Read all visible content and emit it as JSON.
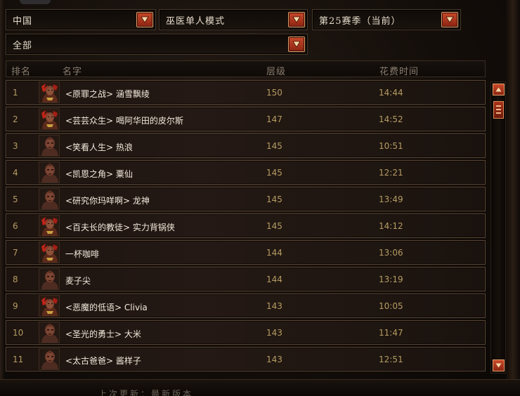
{
  "filters": {
    "region": "中国",
    "class_mode": "巫医单人模式",
    "season": "第25赛季（当前）",
    "category": "全部"
  },
  "columns": {
    "rank": "排名",
    "name": "名字",
    "tier": "层级",
    "time": "花费时间"
  },
  "rows": [
    {
      "rank": "1",
      "name": "<原罪之战> 涵雪飘绫",
      "tier": "150",
      "time": "14:44",
      "portrait": "female"
    },
    {
      "rank": "2",
      "name": "<芸芸众生> 喝阿华田的皮尔斯",
      "tier": "147",
      "time": "14:52",
      "portrait": "female"
    },
    {
      "rank": "3",
      "name": "<笑看人生> 热浪",
      "tier": "145",
      "time": "10:51",
      "portrait": "male"
    },
    {
      "rank": "4",
      "name": "<凯恩之角> 粟仙",
      "tier": "145",
      "time": "12:21",
      "portrait": "male"
    },
    {
      "rank": "5",
      "name": "<研究你玛咩啊> 龙神",
      "tier": "145",
      "time": "13:49",
      "portrait": "male"
    },
    {
      "rank": "6",
      "name": "<百夫长的教徒> 实力背锅侠",
      "tier": "145",
      "time": "14:12",
      "portrait": "female"
    },
    {
      "rank": "7",
      "name": "一杯咖啡",
      "tier": "144",
      "time": "13:06",
      "portrait": "female"
    },
    {
      "rank": "8",
      "name": "麦子尖",
      "tier": "144",
      "time": "13:19",
      "portrait": "male"
    },
    {
      "rank": "9",
      "name": "<恶魔的低语> Clivia",
      "tier": "143",
      "time": "10:05",
      "portrait": "female"
    },
    {
      "rank": "10",
      "name": "<圣光的勇士> 大米",
      "tier": "143",
      "time": "11:47",
      "portrait": "male"
    },
    {
      "rank": "11",
      "name": "<太古爸爸> 酱样子",
      "tier": "143",
      "time": "12:51",
      "portrait": "male"
    }
  ],
  "footer": {
    "text": "上次更新：最新版本"
  },
  "icons": {
    "dropdown_arrow": "chevron-down-icon",
    "scroll_up": "chevron-up-icon",
    "scroll_down": "chevron-down-icon",
    "portrait_female": "witch-doctor-female-icon",
    "portrait_male": "witch-doctor-male-icon"
  },
  "colors": {
    "accent_red": "#b5361c",
    "value_gold": "#b59c62",
    "name_text": "#f2eadc"
  }
}
